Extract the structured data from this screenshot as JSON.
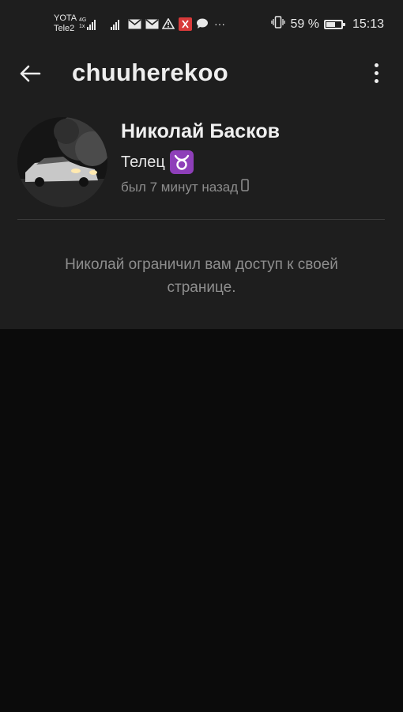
{
  "status_bar": {
    "carrier_1": "YOTA",
    "carrier_2": "Tele2",
    "net_type_top": "4G",
    "net_type_bottom": "1x",
    "overflow": "···",
    "battery_text": "59 %",
    "battery_level": 0.59,
    "time": "15:13",
    "icons": [
      "signal-icon",
      "mail-icon",
      "mail-icon",
      "warning-icon",
      "app-x-icon",
      "chat-icon",
      "vibrate-icon",
      "battery-icon"
    ]
  },
  "header": {
    "title": "chuuherekoo",
    "back_icon": "arrow-left-icon",
    "menu_icon": "more-vertical-icon"
  },
  "profile": {
    "name": "Николай Басков",
    "zodiac_label": "Телец",
    "zodiac_symbol": "♉",
    "last_seen": "был 7 минут назад",
    "device_icon": "phone-icon",
    "restricted_message": "Николай ограничил вам доступ к своей странице."
  },
  "colors": {
    "background": "#0b0b0b",
    "surface": "#1e1e1e",
    "zodiac_badge": "#8e3fb9",
    "secondary_text": "#8c8c8c"
  }
}
